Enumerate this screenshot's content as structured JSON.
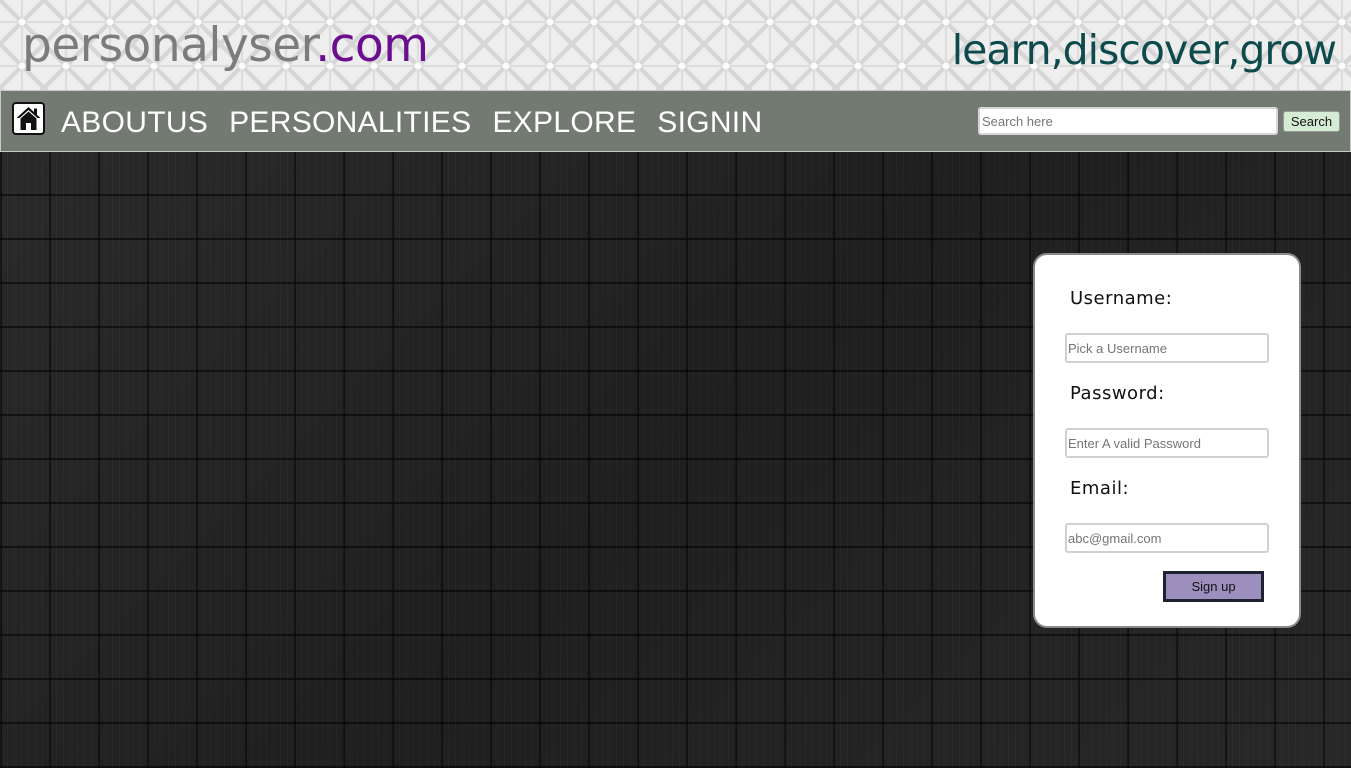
{
  "header": {
    "logo_name": "personalyser",
    "logo_tld": ".com",
    "tagline": "learn,discover,grow"
  },
  "nav": {
    "home_icon": "home-icon",
    "items": [
      {
        "label": "ABOUTUS"
      },
      {
        "label": "PERSONALITIES"
      },
      {
        "label": "EXPLORE"
      },
      {
        "label": "SIGNIN"
      }
    ],
    "search": {
      "placeholder": "Search here",
      "value": "",
      "button_label": "Search"
    }
  },
  "signup_form": {
    "username_label": "Username:",
    "username_placeholder": "Pick a Username",
    "password_label": "Password:",
    "password_placeholder": "Enter A valid Password",
    "email_label": "Email:",
    "email_placeholder": "abc@gmail.com",
    "submit_label": "Sign up"
  },
  "colors": {
    "logo_gray": "#7c7c7c",
    "logo_purple": "#6a0d8e",
    "tagline_teal": "#0d4a4b",
    "navbar_bg": "#727a72",
    "search_btn_bg": "#d5ecd4",
    "signup_btn_bg": "#9c8fbe",
    "page_bg": "#252525"
  }
}
